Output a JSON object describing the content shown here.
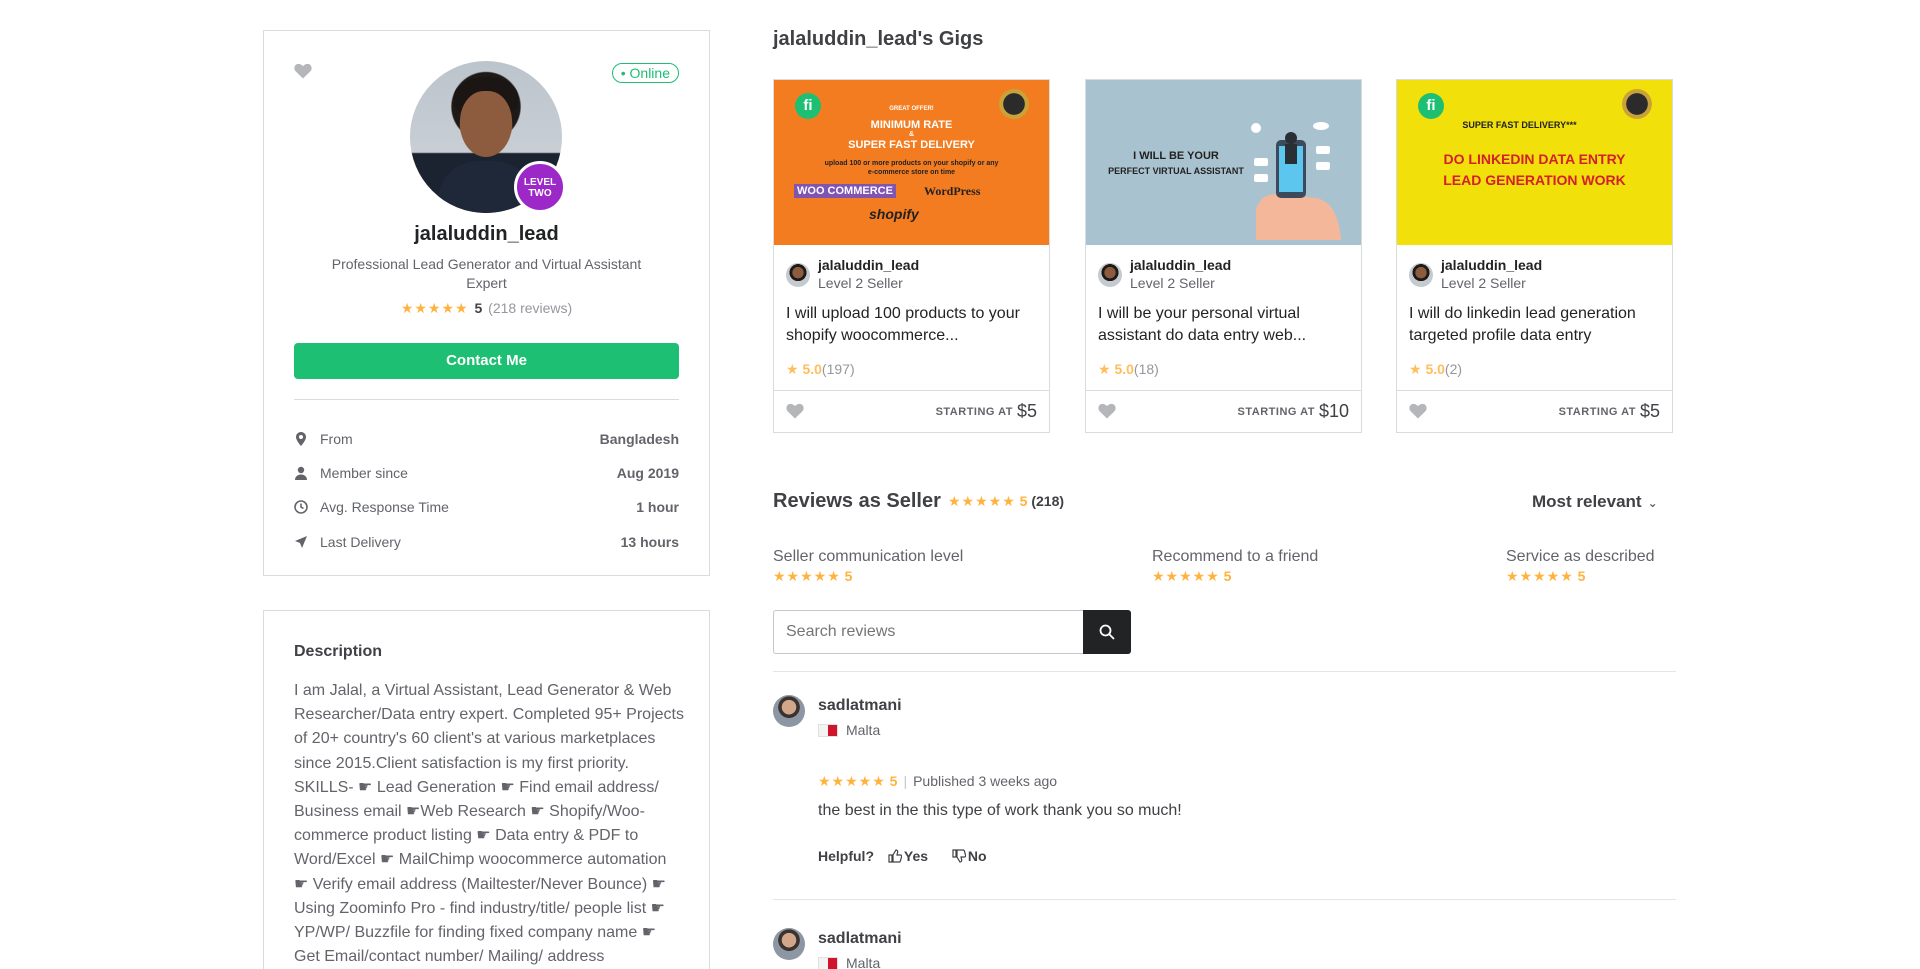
{
  "profile": {
    "username": "jalaluddin_lead",
    "online_label": "• Online",
    "level_badge": "LEVEL\nTWO",
    "tagline": "Professional Lead Generator and Virtual Assistant Expert",
    "stars": "★★★★★",
    "rating_score": "5",
    "review_count": "(218 reviews)",
    "contact_label": "Contact Me",
    "stats": [
      {
        "label": "From",
        "value": "Bangladesh",
        "icon": "location-pin-icon"
      },
      {
        "label": "Member since",
        "value": "Aug 2019",
        "icon": "user-icon"
      },
      {
        "label": "Avg. Response Time",
        "value": "1 hour",
        "icon": "clock-icon"
      },
      {
        "label": "Last Delivery",
        "value": "13 hours",
        "icon": "send-icon"
      }
    ]
  },
  "description": {
    "title": "Description",
    "text": "I am Jalal, a Virtual Assistant, Lead Generator & Web Researcher/Data entry expert. Completed 95+ Projects of 20+ country's 60 client's at various marketplaces since 2015.Client satisfaction is my first priority. SKILLS- ☛ Lead Generation ☛ Find email address/ Business email ☛Web Research ☛ Shopify/Woo-commerce product listing ☛ Data entry & PDF to Word/Excel ☛ MailChimp woocommerce automation ☛ Verify email address (Mailtester/Never Bounce) ☛ Using Zoominfo Pro - find industry/title/ people list ☛ YP/WP/ Buzzfile for finding fixed company name ☛ Get Email/contact number/ Mailing/ address"
  },
  "gigs": {
    "title": "jalaluddin_lead's Gigs",
    "items": [
      {
        "image_lines": [
          "GREAT OFFER!",
          "MINIMUM RATE",
          "&",
          "SUPER FAST DELIVERY",
          "upload 100 or more products on your shopify or any",
          "e-commerce store on time",
          "WOO COMMERCE",
          "WordPress",
          "shopify"
        ],
        "seller": "jalaluddin_lead",
        "level": "Level 2 Seller",
        "desc": "I will upload 100 products to your shopify woocommerce...",
        "rating": "5.0",
        "count": "(197)",
        "starting": "STARTING AT",
        "price": "$5",
        "bg": "#f47c20"
      },
      {
        "image_lines": [
          "I WILL BE YOUR",
          "PERFECT VIRTUAL ASSISTANT"
        ],
        "seller": "jalaluddin_lead",
        "level": "Level 2 Seller",
        "desc": "I will be your personal virtual assistant do data entry web...",
        "rating": "5.0",
        "count": "(18)",
        "starting": "STARTING AT",
        "price": "$10",
        "bg": "#a9c2cf"
      },
      {
        "image_lines": [
          "SUPER FAST DELIVERY***",
          "DO LINKEDIN DATA ENTRY",
          "LEAD GENERATION WORK"
        ],
        "seller": "jalaluddin_lead",
        "level": "Level 2 Seller",
        "desc": "I will do linkedin lead generation targeted profile data entry",
        "rating": "5.0",
        "count": "(2)",
        "starting": "STARTING AT",
        "price": "$5",
        "bg": "#f2e00b"
      }
    ]
  },
  "reviews": {
    "title": "Reviews as Seller",
    "stars": "★★★★★",
    "score": "5",
    "count": "(218)",
    "sort_label": "Most relevant",
    "metrics": [
      {
        "label": "Seller communication level",
        "value": "5"
      },
      {
        "label": "Recommend to a friend",
        "value": "5"
      },
      {
        "label": "Service as described",
        "value": "5"
      }
    ],
    "search_placeholder": "Search reviews",
    "items": [
      {
        "name": "sadlatmani",
        "country": "Malta",
        "rating": "5",
        "published": "Published 3 weeks ago",
        "text": "the best in the this type of work thank you so much!",
        "helpful_label": "Helpful?",
        "yes_label": "Yes",
        "no_label": "No"
      },
      {
        "name": "sadlatmani",
        "country": "Malta"
      }
    ]
  },
  "colors": {
    "accent_green": "#1dbf73",
    "star_gold": "#ffb33e",
    "level_purple": "#9b28c7"
  }
}
